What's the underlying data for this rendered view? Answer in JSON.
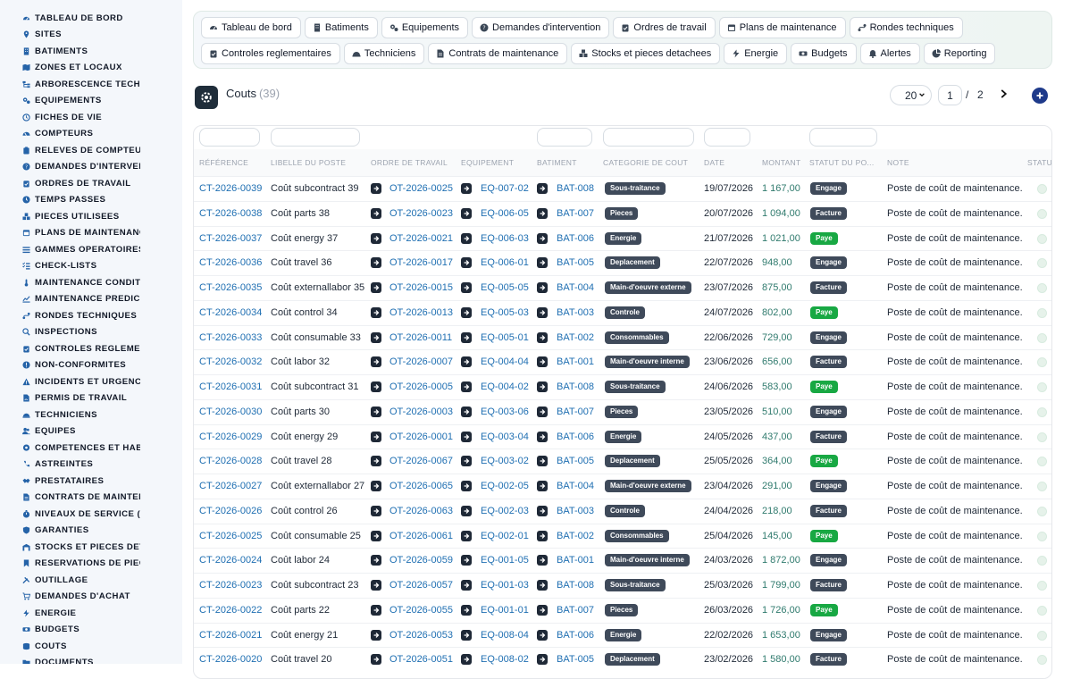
{
  "sidebar": {
    "items": [
      {
        "label": "TABLEAU DE BORD",
        "icon": "dashboard-icon"
      },
      {
        "label": "SITES",
        "icon": "map-pin-icon"
      },
      {
        "label": "BATIMENTS",
        "icon": "building-icon"
      },
      {
        "label": "ZONES ET LOCAUX",
        "icon": "map-icon"
      },
      {
        "label": "ARBORESCENCE TECHNI",
        "icon": "tree-icon"
      },
      {
        "label": "EQUIPEMENTS",
        "icon": "gears-icon"
      },
      {
        "label": "FICHES DE VIE",
        "icon": "history-icon"
      },
      {
        "label": "COMPTEURS",
        "icon": "gauge-icon"
      },
      {
        "label": "RELEVES DE COMPTEURS",
        "icon": "clipboard-icon"
      },
      {
        "label": "DEMANDES D'INTERVENT",
        "icon": "question-icon"
      },
      {
        "label": "ORDRES DE TRAVAIL",
        "icon": "clipboard-check-icon"
      },
      {
        "label": "TEMPS PASSES",
        "icon": "clock-icon"
      },
      {
        "label": "PIECES UTILISEES",
        "icon": "boxes-icon"
      },
      {
        "label": "PLANS DE MAINTENANCE",
        "icon": "calendar-icon"
      },
      {
        "label": "GAMMES OPERATOIRES",
        "icon": "list-icon"
      },
      {
        "label": "CHECK-LISTS",
        "icon": "checklist-icon"
      },
      {
        "label": "MAINTENANCE CONDITIO",
        "icon": "thermometer-icon"
      },
      {
        "label": "MAINTENANCE PREDICTI",
        "icon": "chart-line-icon"
      },
      {
        "label": "RONDES TECHNIQUES",
        "icon": "route-icon"
      },
      {
        "label": "INSPECTIONS",
        "icon": "search-icon"
      },
      {
        "label": "CONTROLES REGLEMENT",
        "icon": "clipboard-check-icon"
      },
      {
        "label": "NON-CONFORMITES",
        "icon": "alert-circle-icon"
      },
      {
        "label": "INCIDENTS ET URGENCES",
        "icon": "warning-icon"
      },
      {
        "label": "PERMIS DE TRAVAIL",
        "icon": "file-signature-icon"
      },
      {
        "label": "TECHNICIENS",
        "icon": "hard-hat-icon"
      },
      {
        "label": "EQUIPES",
        "icon": "users-icon"
      },
      {
        "label": "COMPETENCES ET HABIL",
        "icon": "certificate-icon"
      },
      {
        "label": "ASTREINTES",
        "icon": "phone-icon"
      },
      {
        "label": "PRESTATAIRES",
        "icon": "handshake-icon"
      },
      {
        "label": "CONTRATS DE MAINTENA",
        "icon": "file-contract-icon"
      },
      {
        "label": "NIVEAUX DE SERVICE (SL",
        "icon": "stopwatch-icon"
      },
      {
        "label": "GARANTIES",
        "icon": "shield-icon"
      },
      {
        "label": "STOCKS ET PIECES DETA",
        "icon": "warehouse-icon"
      },
      {
        "label": "RESERVATIONS DE PIECE",
        "icon": "bookmark-icon"
      },
      {
        "label": "OUTILLAGE",
        "icon": "tools-icon"
      },
      {
        "label": "DEMANDES D'ACHAT",
        "icon": "cart-icon"
      },
      {
        "label": "ENERGIE",
        "icon": "bolt-icon"
      },
      {
        "label": "BUDGETS",
        "icon": "money-icon"
      },
      {
        "label": "COUTS",
        "icon": "coins-icon"
      },
      {
        "label": "DOCUMENTS",
        "icon": "folder-icon"
      }
    ]
  },
  "topnav": {
    "row1": [
      {
        "label": "Tableau de bord",
        "icon": "dashboard-icon"
      },
      {
        "label": "Batiments",
        "icon": "building-icon"
      },
      {
        "label": "Equipements",
        "icon": "gears-icon"
      },
      {
        "label": "Demandes d'intervention",
        "icon": "question-icon"
      },
      {
        "label": "Ordres de travail",
        "icon": "clipboard-check-icon"
      },
      {
        "label": "Plans de maintenance",
        "icon": "calendar-icon"
      },
      {
        "label": "Rondes techniques",
        "icon": "route-icon"
      }
    ],
    "row2": [
      {
        "label": "Controles reglementaires",
        "icon": "clipboard-check-icon"
      },
      {
        "label": "Techniciens",
        "icon": "hard-hat-icon"
      },
      {
        "label": "Contrats de maintenance",
        "icon": "file-contract-icon"
      },
      {
        "label": "Stocks et pieces detachees",
        "icon": "boxes-icon"
      },
      {
        "label": "Energie",
        "icon": "bolt-icon"
      },
      {
        "label": "Budgets",
        "icon": "money-icon"
      },
      {
        "label": "Alertes",
        "icon": "bell-icon"
      },
      {
        "label": "Reporting",
        "icon": "pie-chart-icon"
      }
    ]
  },
  "header": {
    "title": "Couts",
    "count": "(39)",
    "page_size": "20",
    "page_current": "1",
    "page_sep": "/",
    "page_total": "2"
  },
  "table": {
    "columns": [
      "RÉFÉRENCE",
      "LIBELLE DU POSTE",
      "ORDRE DE TRAVAIL",
      "EQUIPEMENT",
      "BATIMENT",
      "CATEGORIE DE COUT",
      "DATE",
      "MONTANT",
      "STATUT DU PO...",
      "NOTE",
      "STATU"
    ],
    "rows": [
      {
        "ref": "CT-2026-0039",
        "label": "Coût subcontract 39",
        "ot": "OT-2026-0025",
        "eq": "EQ-007-02",
        "bat": "BAT-008",
        "cat": "Sous-traitance",
        "date": "19/07/2026",
        "amount": "1 167,00",
        "status": "Engage",
        "note": "Poste de coût de maintenance."
      },
      {
        "ref": "CT-2026-0038",
        "label": "Coût parts 38",
        "ot": "OT-2026-0023",
        "eq": "EQ-006-05",
        "bat": "BAT-007",
        "cat": "Pieces",
        "date": "20/07/2026",
        "amount": "1 094,00",
        "status": "Facture",
        "note": "Poste de coût de maintenance."
      },
      {
        "ref": "CT-2026-0037",
        "label": "Coût energy 37",
        "ot": "OT-2026-0021",
        "eq": "EQ-006-03",
        "bat": "BAT-006",
        "cat": "Energie",
        "date": "21/07/2026",
        "amount": "1 021,00",
        "status": "Paye",
        "note": "Poste de coût de maintenance."
      },
      {
        "ref": "CT-2026-0036",
        "label": "Coût travel 36",
        "ot": "OT-2026-0017",
        "eq": "EQ-006-01",
        "bat": "BAT-005",
        "cat": "Deplacement",
        "date": "22/07/2026",
        "amount": "948,00",
        "status": "Engage",
        "note": "Poste de coût de maintenance."
      },
      {
        "ref": "CT-2026-0035",
        "label": "Coût externallabor 35",
        "ot": "OT-2026-0015",
        "eq": "EQ-005-05",
        "bat": "BAT-004",
        "cat": "Main-d'oeuvre externe",
        "date": "23/07/2026",
        "amount": "875,00",
        "status": "Facture",
        "note": "Poste de coût de maintenance."
      },
      {
        "ref": "CT-2026-0034",
        "label": "Coût control 34",
        "ot": "OT-2026-0013",
        "eq": "EQ-005-03",
        "bat": "BAT-003",
        "cat": "Controle",
        "date": "24/07/2026",
        "amount": "802,00",
        "status": "Paye",
        "note": "Poste de coût de maintenance."
      },
      {
        "ref": "CT-2026-0033",
        "label": "Coût consumable 33",
        "ot": "OT-2026-0011",
        "eq": "EQ-005-01",
        "bat": "BAT-002",
        "cat": "Consommables",
        "date": "22/06/2026",
        "amount": "729,00",
        "status": "Engage",
        "note": "Poste de coût de maintenance."
      },
      {
        "ref": "CT-2026-0032",
        "label": "Coût labor 32",
        "ot": "OT-2026-0007",
        "eq": "EQ-004-04",
        "bat": "BAT-001",
        "cat": "Main-d'oeuvre interne",
        "date": "23/06/2026",
        "amount": "656,00",
        "status": "Facture",
        "note": "Poste de coût de maintenance."
      },
      {
        "ref": "CT-2026-0031",
        "label": "Coût subcontract 31",
        "ot": "OT-2026-0005",
        "eq": "EQ-004-02",
        "bat": "BAT-008",
        "cat": "Sous-traitance",
        "date": "24/06/2026",
        "amount": "583,00",
        "status": "Paye",
        "note": "Poste de coût de maintenance."
      },
      {
        "ref": "CT-2026-0030",
        "label": "Coût parts 30",
        "ot": "OT-2026-0003",
        "eq": "EQ-003-06",
        "bat": "BAT-007",
        "cat": "Pieces",
        "date": "23/05/2026",
        "amount": "510,00",
        "status": "Engage",
        "note": "Poste de coût de maintenance."
      },
      {
        "ref": "CT-2026-0029",
        "label": "Coût energy 29",
        "ot": "OT-2026-0001",
        "eq": "EQ-003-04",
        "bat": "BAT-006",
        "cat": "Energie",
        "date": "24/05/2026",
        "amount": "437,00",
        "status": "Facture",
        "note": "Poste de coût de maintenance."
      },
      {
        "ref": "CT-2026-0028",
        "label": "Coût travel 28",
        "ot": "OT-2026-0067",
        "eq": "EQ-003-02",
        "bat": "BAT-005",
        "cat": "Deplacement",
        "date": "25/05/2026",
        "amount": "364,00",
        "status": "Paye",
        "note": "Poste de coût de maintenance."
      },
      {
        "ref": "CT-2026-0027",
        "label": "Coût externallabor 27",
        "ot": "OT-2026-0065",
        "eq": "EQ-002-05",
        "bat": "BAT-004",
        "cat": "Main-d'oeuvre externe",
        "date": "23/04/2026",
        "amount": "291,00",
        "status": "Engage",
        "note": "Poste de coût de maintenance."
      },
      {
        "ref": "CT-2026-0026",
        "label": "Coût control 26",
        "ot": "OT-2026-0063",
        "eq": "EQ-002-03",
        "bat": "BAT-003",
        "cat": "Controle",
        "date": "24/04/2026",
        "amount": "218,00",
        "status": "Facture",
        "note": "Poste de coût de maintenance."
      },
      {
        "ref": "CT-2026-0025",
        "label": "Coût consumable 25",
        "ot": "OT-2026-0061",
        "eq": "EQ-002-01",
        "bat": "BAT-002",
        "cat": "Consommables",
        "date": "25/04/2026",
        "amount": "145,00",
        "status": "Paye",
        "note": "Poste de coût de maintenance."
      },
      {
        "ref": "CT-2026-0024",
        "label": "Coût labor 24",
        "ot": "OT-2026-0059",
        "eq": "EQ-001-05",
        "bat": "BAT-001",
        "cat": "Main-d'oeuvre interne",
        "date": "24/03/2026",
        "amount": "1 872,00",
        "status": "Engage",
        "note": "Poste de coût de maintenance."
      },
      {
        "ref": "CT-2026-0023",
        "label": "Coût subcontract 23",
        "ot": "OT-2026-0057",
        "eq": "EQ-001-03",
        "bat": "BAT-008",
        "cat": "Sous-traitance",
        "date": "25/03/2026",
        "amount": "1 799,00",
        "status": "Facture",
        "note": "Poste de coût de maintenance."
      },
      {
        "ref": "CT-2026-0022",
        "label": "Coût parts 22",
        "ot": "OT-2026-0055",
        "eq": "EQ-001-01",
        "bat": "BAT-007",
        "cat": "Pieces",
        "date": "26/03/2026",
        "amount": "1 726,00",
        "status": "Paye",
        "note": "Poste de coût de maintenance."
      },
      {
        "ref": "CT-2026-0021",
        "label": "Coût energy 21",
        "ot": "OT-2026-0053",
        "eq": "EQ-008-04",
        "bat": "BAT-006",
        "cat": "Energie",
        "date": "22/02/2026",
        "amount": "1 653,00",
        "status": "Engage",
        "note": "Poste de coût de maintenance."
      },
      {
        "ref": "CT-2026-0020",
        "label": "Coût travel 20",
        "ot": "OT-2026-0051",
        "eq": "EQ-008-02",
        "bat": "BAT-005",
        "cat": "Deplacement",
        "date": "23/02/2026",
        "amount": "1 580,00",
        "status": "Facture",
        "note": "Poste de coût de maintenance."
      }
    ]
  },
  "colors": {
    "accent": "#1f6fb2",
    "amount": "#2f7a6d",
    "paye_badge": "#18a843",
    "badge_dark": "#3f4a5a",
    "add_button": "#1e3a8a"
  }
}
